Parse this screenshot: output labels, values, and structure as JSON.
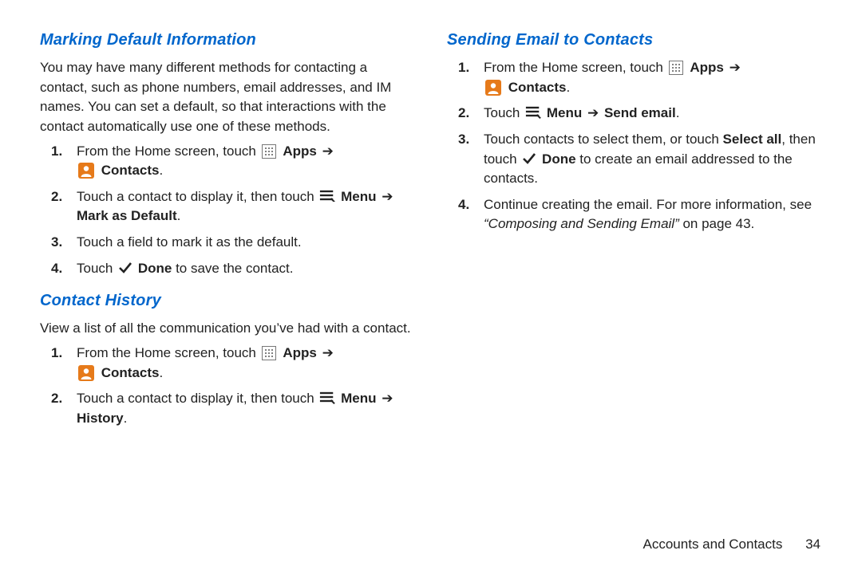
{
  "left": {
    "section1": {
      "title": "Marking Default Information",
      "intro": "You may have many different methods for contacting a contact, such as phone numbers, email addresses, and IM names. You can set a default, so that interactions with the contact automatically use one of these methods.",
      "steps": [
        {
          "num": "1.",
          "pre": "From the Home screen, touch ",
          "apps": "Apps",
          "arrow": "➔",
          "contacts": "Contacts",
          "suffix": "."
        },
        {
          "num": "2.",
          "pre": "Touch a contact to display it, then touch ",
          "menu": "Menu",
          "arrow": "➔",
          "mark": "Mark as Default",
          "suffix": "."
        },
        {
          "num": "3.",
          "text": "Touch a field to mark it as the default."
        },
        {
          "num": "4.",
          "pre": "Touch ",
          "done": "Done",
          "post": " to save the contact."
        }
      ]
    },
    "section2": {
      "title": "Contact History",
      "intro": "View a list of all the communication you’ve had with a contact.",
      "steps": [
        {
          "num": "1.",
          "pre": "From the Home screen, touch ",
          "apps": "Apps",
          "arrow": "➔",
          "contacts": "Contacts",
          "suffix": "."
        },
        {
          "num": "2.",
          "pre": "Touch a contact to display it, then touch ",
          "menu": "Menu",
          "arrow": "➔",
          "history": "History",
          "suffix": "."
        }
      ]
    }
  },
  "right": {
    "section1": {
      "title": "Sending Email to Contacts",
      "steps": [
        {
          "num": "1.",
          "pre": "From the Home screen, touch ",
          "apps": "Apps",
          "arrow": "➔",
          "contacts": "Contacts",
          "suffix": "."
        },
        {
          "num": "2.",
          "pre": "Touch ",
          "menu": "Menu",
          "arrow": "➔",
          "send": "Send email",
          "suffix": "."
        },
        {
          "num": "3.",
          "pre": "Touch contacts to select them, or touch ",
          "selectall": "Select all",
          "mid1": ", then touch ",
          "done": "Done",
          "post": " to create an email addressed to the contacts."
        },
        {
          "num": "4.",
          "pre": "Continue creating the email. For more information, see ",
          "ref": "“Composing and Sending Email”",
          "post": " on page 43."
        }
      ]
    }
  },
  "footer": {
    "section": "Accounts and Contacts",
    "page": "34"
  }
}
